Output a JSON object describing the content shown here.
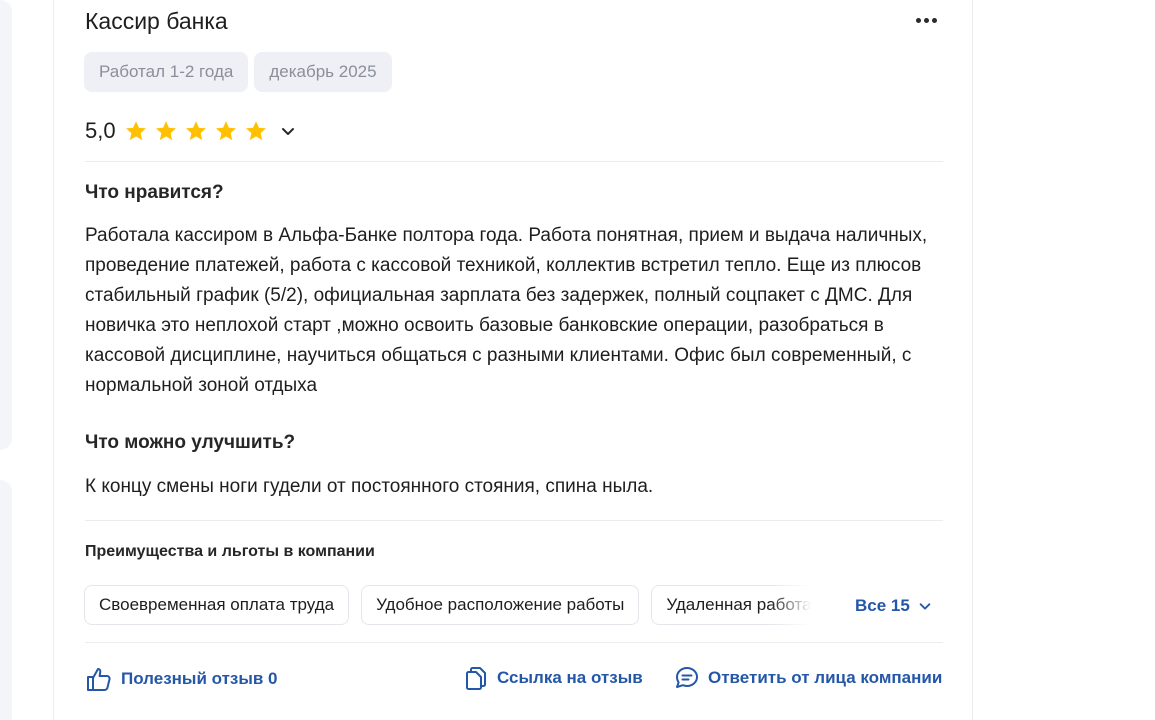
{
  "review": {
    "title": "Кассир банка",
    "tags": [
      "Работал 1-2 года",
      "декабрь 2025"
    ],
    "rating": "5,0",
    "stars_filled": 5,
    "stars_total": 5,
    "pros_title": "Что нравится?",
    "pros_text": "Работала кассиром в Альфа-Банке полтора года. Работа понятная, прием и выдача наличных, проведение платежей, работа с кассовой техникой, коллектив встретил тепло. Еще из плюсов стабильный график (5/2), официальная зарплата без задержек, полный соцпакет с ДМС. Для новичка это неплохой старт ,можно освоить базовые банковские операции, разобраться в кассовой дисциплине, научиться общаться с разными клиентами. Офис был современный, с нормальной зоной отдыха",
    "cons_title": "Что можно улучшить?",
    "cons_text": "К концу смены ноги гудели от постоянного стояния, спина ныла."
  },
  "benefits": {
    "title": "Преимущества и льготы в компании",
    "items": [
      "Своевременная оплата труда",
      "Удобное расположение работы",
      "Удаленная работа"
    ],
    "all_label": "Все 15"
  },
  "actions": {
    "helpful_label": "Полезный отзыв 0",
    "link_label": "Ссылка на отзыв",
    "reply_label": "Ответить от лица компании"
  },
  "colors": {
    "accent": "#2457a8",
    "star": "#ffc000",
    "tag_bg": "#eef0f5"
  },
  "icons": {
    "more": "more-dots-icon",
    "star": "star-icon",
    "chevron": "chevron-down-icon",
    "helpful": "thumbs-up-icon",
    "link": "copy-link-icon",
    "reply": "chat-bubble-icon"
  }
}
